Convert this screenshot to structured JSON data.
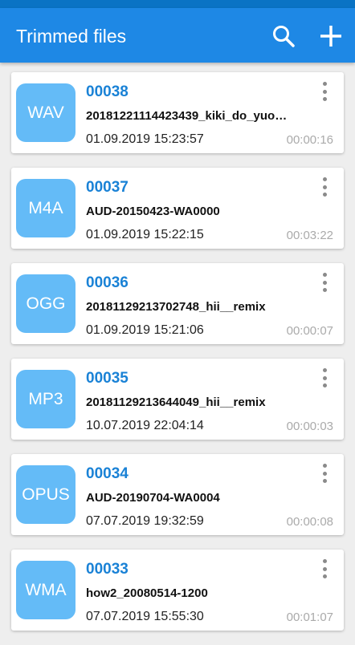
{
  "app": {
    "title": "Trimmed files"
  },
  "colors": {
    "appbar": "#1e88e5",
    "badge": "#64bbf7",
    "accent": "#1a82d6"
  },
  "icons": {
    "search": "search-icon",
    "add": "plus-icon",
    "overflow": "more-vertical-icon"
  },
  "files": [
    {
      "format": "WAV",
      "number": "00038",
      "name": "20181221114423439_kiki_do_yuo…",
      "date": "01.09.2019  15:23:57",
      "duration": "00:00:16"
    },
    {
      "format": "M4A",
      "number": "00037",
      "name": "AUD-20150423-WA0000",
      "date": "01.09.2019  15:22:15",
      "duration": "00:03:22"
    },
    {
      "format": "OGG",
      "number": "00036",
      "name": "20181129213702748_hii__remix",
      "date": "01.09.2019  15:21:06",
      "duration": "00:00:07"
    },
    {
      "format": "MP3",
      "number": "00035",
      "name": "20181129213644049_hii__remix",
      "date": "10.07.2019  22:04:14",
      "duration": "00:00:03"
    },
    {
      "format": "OPUS",
      "number": "00034",
      "name": "AUD-20190704-WA0004",
      "date": "07.07.2019  19:32:59",
      "duration": "00:00:08"
    },
    {
      "format": "WMA",
      "number": "00033",
      "name": "how2_20080514-1200",
      "date": "07.07.2019  15:55:30",
      "duration": "00:01:07"
    }
  ]
}
